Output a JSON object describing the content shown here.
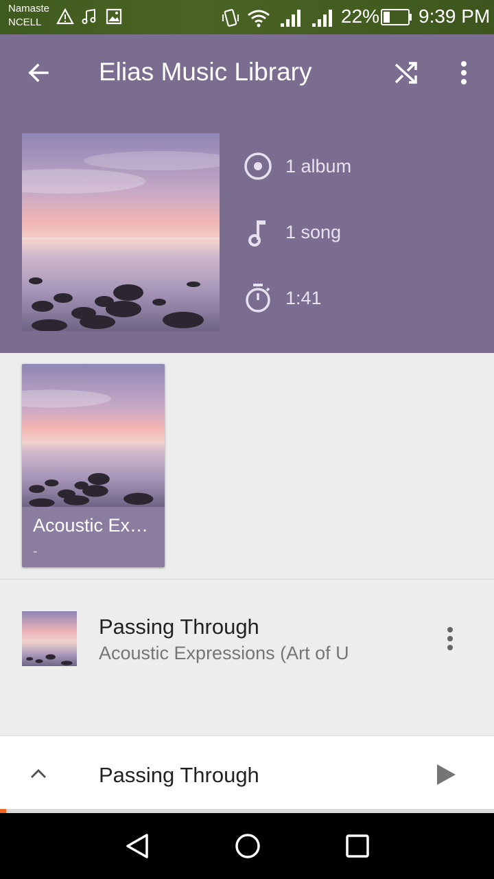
{
  "status_bar": {
    "carrier_line1": "Namaste",
    "carrier_line2": "NCELL",
    "battery": "22%",
    "time": "9:39 PM",
    "icons": [
      "warning-icon",
      "music-note-icon",
      "image-icon",
      "vibrate-icon",
      "wifi-icon",
      "signal-icon",
      "signal-icon",
      "battery-icon"
    ]
  },
  "app_bar": {
    "title": "Elias Music Library",
    "back_icon": "arrow-back-icon",
    "shuffle_icon": "shuffle-icon",
    "more_icon": "more-vert-icon"
  },
  "header": {
    "background": "#7b6d8f",
    "stats": {
      "albums": "1 album",
      "songs": "1 song",
      "duration": "1:41"
    }
  },
  "albums": [
    {
      "title": "Acoustic Ex…",
      "subtitle": "-"
    }
  ],
  "songs": [
    {
      "title": "Passing Through",
      "subtitle": "Acoustic Expressions (Art of U"
    }
  ],
  "player": {
    "title": "Passing Through",
    "progress": 0.012,
    "accent": "#f26522"
  },
  "nav": {
    "icons": [
      "back-triangle-icon",
      "home-circle-icon",
      "recents-square-icon"
    ]
  }
}
